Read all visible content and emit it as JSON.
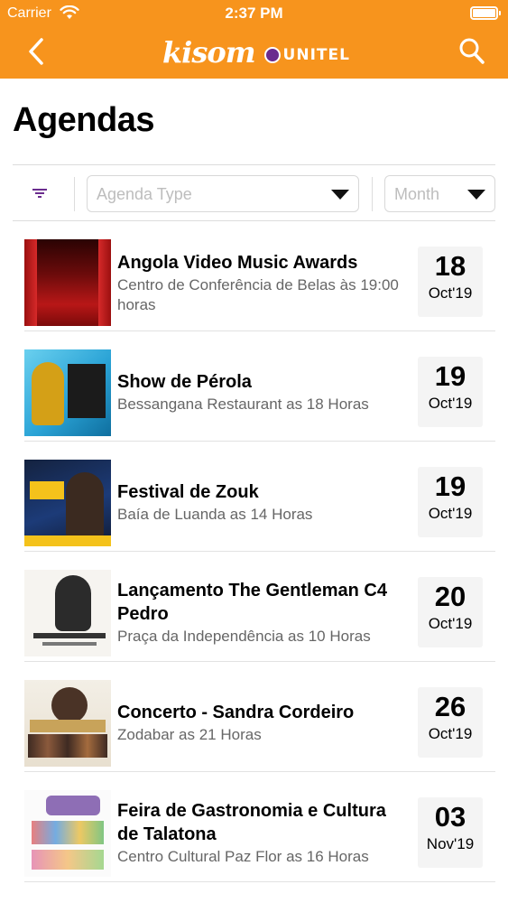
{
  "status_bar": {
    "carrier": "Carrier",
    "time": "2:37 PM"
  },
  "nav": {
    "logo_main": "kisom",
    "logo_brand": "UNITEL",
    "back_icon": "chevron-left-icon",
    "search_icon": "search-icon"
  },
  "page": {
    "title": "Agendas"
  },
  "filters": {
    "filter_icon": "filter-icon",
    "agenda_type_placeholder": "Agenda Type",
    "month_placeholder": "Month"
  },
  "colors": {
    "brand": "#F7941D",
    "filter_icon": "#6A2C8E"
  },
  "events": [
    {
      "title": "Angola Video Music Awards",
      "subtitle": "Centro de Conferência de Belas às 19:00 horas",
      "day": "18",
      "month": "Oct'19"
    },
    {
      "title": "Show de Pérola",
      "subtitle": "Bessangana Restaurant as 18 Horas",
      "day": "19",
      "month": "Oct'19"
    },
    {
      "title": "Festival de Zouk",
      "subtitle": "Baía de Luanda as 14 Horas",
      "day": "19",
      "month": "Oct'19"
    },
    {
      "title": "Lançamento The Gentleman C4 Pedro",
      "subtitle": "Praça da Independência as 10 Horas",
      "day": "20",
      "month": "Oct'19"
    },
    {
      "title": "Concerto - Sandra Cordeiro",
      "subtitle": "Zodabar as 21 Horas",
      "day": "26",
      "month": "Oct'19"
    },
    {
      "title": "Feira de Gastronomia e Cultura de Talatona",
      "subtitle": "Centro Cultural Paz Flor as 16 Horas",
      "day": "03",
      "month": "Nov'19"
    }
  ]
}
